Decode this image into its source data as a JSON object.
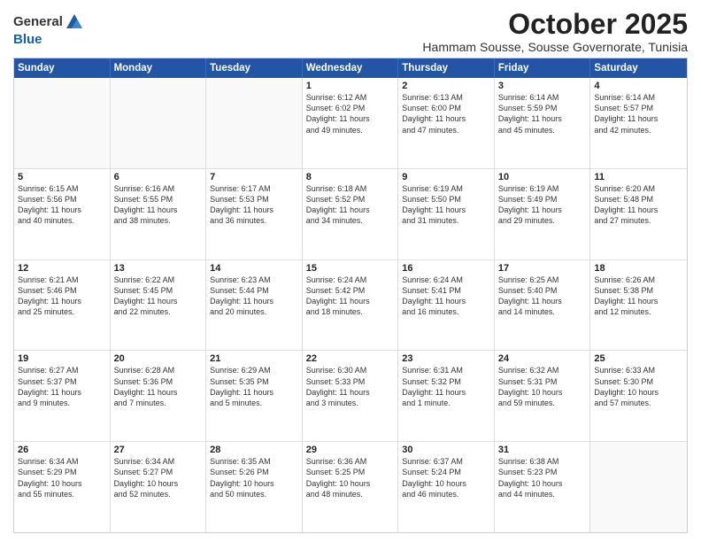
{
  "logo": {
    "general": "General",
    "blue": "Blue"
  },
  "header": {
    "month": "October 2025",
    "location": "Hammam Sousse, Sousse Governorate, Tunisia"
  },
  "days": [
    "Sunday",
    "Monday",
    "Tuesday",
    "Wednesday",
    "Thursday",
    "Friday",
    "Saturday"
  ],
  "weeks": [
    [
      {
        "day": "",
        "lines": []
      },
      {
        "day": "",
        "lines": []
      },
      {
        "day": "",
        "lines": []
      },
      {
        "day": "1",
        "lines": [
          "Sunrise: 6:12 AM",
          "Sunset: 6:02 PM",
          "Daylight: 11 hours",
          "and 49 minutes."
        ]
      },
      {
        "day": "2",
        "lines": [
          "Sunrise: 6:13 AM",
          "Sunset: 6:00 PM",
          "Daylight: 11 hours",
          "and 47 minutes."
        ]
      },
      {
        "day": "3",
        "lines": [
          "Sunrise: 6:14 AM",
          "Sunset: 5:59 PM",
          "Daylight: 11 hours",
          "and 45 minutes."
        ]
      },
      {
        "day": "4",
        "lines": [
          "Sunrise: 6:14 AM",
          "Sunset: 5:57 PM",
          "Daylight: 11 hours",
          "and 42 minutes."
        ]
      }
    ],
    [
      {
        "day": "5",
        "lines": [
          "Sunrise: 6:15 AM",
          "Sunset: 5:56 PM",
          "Daylight: 11 hours",
          "and 40 minutes."
        ]
      },
      {
        "day": "6",
        "lines": [
          "Sunrise: 6:16 AM",
          "Sunset: 5:55 PM",
          "Daylight: 11 hours",
          "and 38 minutes."
        ]
      },
      {
        "day": "7",
        "lines": [
          "Sunrise: 6:17 AM",
          "Sunset: 5:53 PM",
          "Daylight: 11 hours",
          "and 36 minutes."
        ]
      },
      {
        "day": "8",
        "lines": [
          "Sunrise: 6:18 AM",
          "Sunset: 5:52 PM",
          "Daylight: 11 hours",
          "and 34 minutes."
        ]
      },
      {
        "day": "9",
        "lines": [
          "Sunrise: 6:19 AM",
          "Sunset: 5:50 PM",
          "Daylight: 11 hours",
          "and 31 minutes."
        ]
      },
      {
        "day": "10",
        "lines": [
          "Sunrise: 6:19 AM",
          "Sunset: 5:49 PM",
          "Daylight: 11 hours",
          "and 29 minutes."
        ]
      },
      {
        "day": "11",
        "lines": [
          "Sunrise: 6:20 AM",
          "Sunset: 5:48 PM",
          "Daylight: 11 hours",
          "and 27 minutes."
        ]
      }
    ],
    [
      {
        "day": "12",
        "lines": [
          "Sunrise: 6:21 AM",
          "Sunset: 5:46 PM",
          "Daylight: 11 hours",
          "and 25 minutes."
        ]
      },
      {
        "day": "13",
        "lines": [
          "Sunrise: 6:22 AM",
          "Sunset: 5:45 PM",
          "Daylight: 11 hours",
          "and 22 minutes."
        ]
      },
      {
        "day": "14",
        "lines": [
          "Sunrise: 6:23 AM",
          "Sunset: 5:44 PM",
          "Daylight: 11 hours",
          "and 20 minutes."
        ]
      },
      {
        "day": "15",
        "lines": [
          "Sunrise: 6:24 AM",
          "Sunset: 5:42 PM",
          "Daylight: 11 hours",
          "and 18 minutes."
        ]
      },
      {
        "day": "16",
        "lines": [
          "Sunrise: 6:24 AM",
          "Sunset: 5:41 PM",
          "Daylight: 11 hours",
          "and 16 minutes."
        ]
      },
      {
        "day": "17",
        "lines": [
          "Sunrise: 6:25 AM",
          "Sunset: 5:40 PM",
          "Daylight: 11 hours",
          "and 14 minutes."
        ]
      },
      {
        "day": "18",
        "lines": [
          "Sunrise: 6:26 AM",
          "Sunset: 5:38 PM",
          "Daylight: 11 hours",
          "and 12 minutes."
        ]
      }
    ],
    [
      {
        "day": "19",
        "lines": [
          "Sunrise: 6:27 AM",
          "Sunset: 5:37 PM",
          "Daylight: 11 hours",
          "and 9 minutes."
        ]
      },
      {
        "day": "20",
        "lines": [
          "Sunrise: 6:28 AM",
          "Sunset: 5:36 PM",
          "Daylight: 11 hours",
          "and 7 minutes."
        ]
      },
      {
        "day": "21",
        "lines": [
          "Sunrise: 6:29 AM",
          "Sunset: 5:35 PM",
          "Daylight: 11 hours",
          "and 5 minutes."
        ]
      },
      {
        "day": "22",
        "lines": [
          "Sunrise: 6:30 AM",
          "Sunset: 5:33 PM",
          "Daylight: 11 hours",
          "and 3 minutes."
        ]
      },
      {
        "day": "23",
        "lines": [
          "Sunrise: 6:31 AM",
          "Sunset: 5:32 PM",
          "Daylight: 11 hours",
          "and 1 minute."
        ]
      },
      {
        "day": "24",
        "lines": [
          "Sunrise: 6:32 AM",
          "Sunset: 5:31 PM",
          "Daylight: 10 hours",
          "and 59 minutes."
        ]
      },
      {
        "day": "25",
        "lines": [
          "Sunrise: 6:33 AM",
          "Sunset: 5:30 PM",
          "Daylight: 10 hours",
          "and 57 minutes."
        ]
      }
    ],
    [
      {
        "day": "26",
        "lines": [
          "Sunrise: 6:34 AM",
          "Sunset: 5:29 PM",
          "Daylight: 10 hours",
          "and 55 minutes."
        ]
      },
      {
        "day": "27",
        "lines": [
          "Sunrise: 6:34 AM",
          "Sunset: 5:27 PM",
          "Daylight: 10 hours",
          "and 52 minutes."
        ]
      },
      {
        "day": "28",
        "lines": [
          "Sunrise: 6:35 AM",
          "Sunset: 5:26 PM",
          "Daylight: 10 hours",
          "and 50 minutes."
        ]
      },
      {
        "day": "29",
        "lines": [
          "Sunrise: 6:36 AM",
          "Sunset: 5:25 PM",
          "Daylight: 10 hours",
          "and 48 minutes."
        ]
      },
      {
        "day": "30",
        "lines": [
          "Sunrise: 6:37 AM",
          "Sunset: 5:24 PM",
          "Daylight: 10 hours",
          "and 46 minutes."
        ]
      },
      {
        "day": "31",
        "lines": [
          "Sunrise: 6:38 AM",
          "Sunset: 5:23 PM",
          "Daylight: 10 hours",
          "and 44 minutes."
        ]
      },
      {
        "day": "",
        "lines": []
      }
    ]
  ]
}
